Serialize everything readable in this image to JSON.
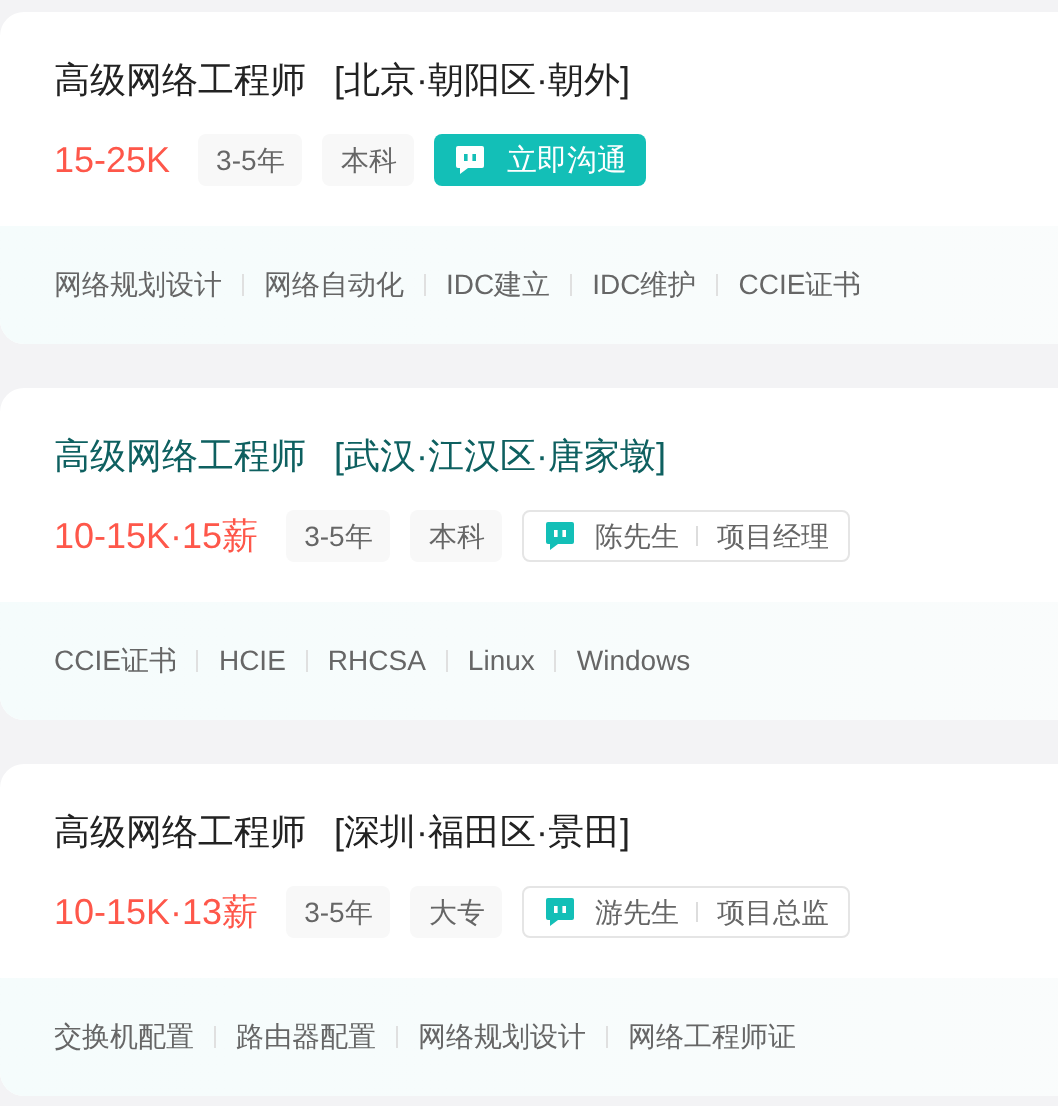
{
  "jobs": [
    {
      "title": "高级网络工程师",
      "location": "[北京·朝阳区·朝外]",
      "hovered": false,
      "salary": "15-25K",
      "tags": [
        "3-5年",
        "本科"
      ],
      "contact": {
        "kind": "chat_button",
        "label": "立即沟通"
      },
      "skills": [
        "网络规划设计",
        "网络自动化",
        "IDC建立",
        "IDC维护",
        "CCIE证书"
      ]
    },
    {
      "title": "高级网络工程师",
      "location": "[武汉·江汉区·唐家墩]",
      "hovered": true,
      "salary": "10-15K·15薪",
      "tags": [
        "3-5年",
        "本科"
      ],
      "contact": {
        "kind": "recruiter",
        "name": "陈先生",
        "role": "项目经理"
      },
      "skills": [
        "CCIE证书",
        "HCIE",
        "RHCSA",
        "Linux",
        "Windows"
      ]
    },
    {
      "title": "高级网络工程师",
      "location": "[深圳·福田区·景田]",
      "hovered": false,
      "salary": "10-15K·13薪",
      "tags": [
        "3-5年",
        "大专"
      ],
      "contact": {
        "kind": "recruiter",
        "name": "游先生",
        "role": "项目总监"
      },
      "skills": [
        "交换机配置",
        "路由器配置",
        "网络规划设计",
        "网络工程师证"
      ]
    }
  ]
}
